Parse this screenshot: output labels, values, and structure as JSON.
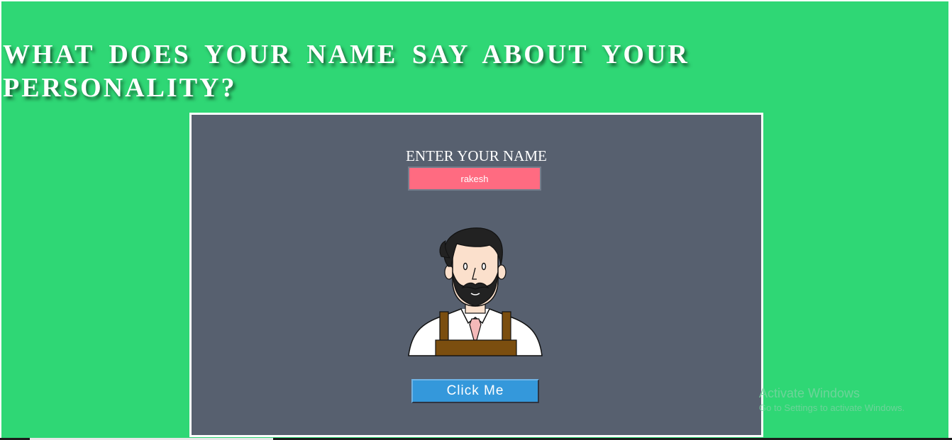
{
  "page": {
    "heading": "WHAT DOES YOUR NAME SAY ABOUT YOUR PERSONALITY?",
    "background_color": "#2fd775"
  },
  "form": {
    "label": "ENTER YOUR NAME",
    "name_value": "rakesh",
    "input_color": "#ff6b81",
    "card_color": "#57606f"
  },
  "avatar": {
    "icon": "bearded-man-apron-icon"
  },
  "button": {
    "label": "Click Me",
    "color": "#3498db"
  },
  "watermark": {
    "title": "Activate Windows",
    "subtitle": "Go to Settings to activate Windows."
  }
}
